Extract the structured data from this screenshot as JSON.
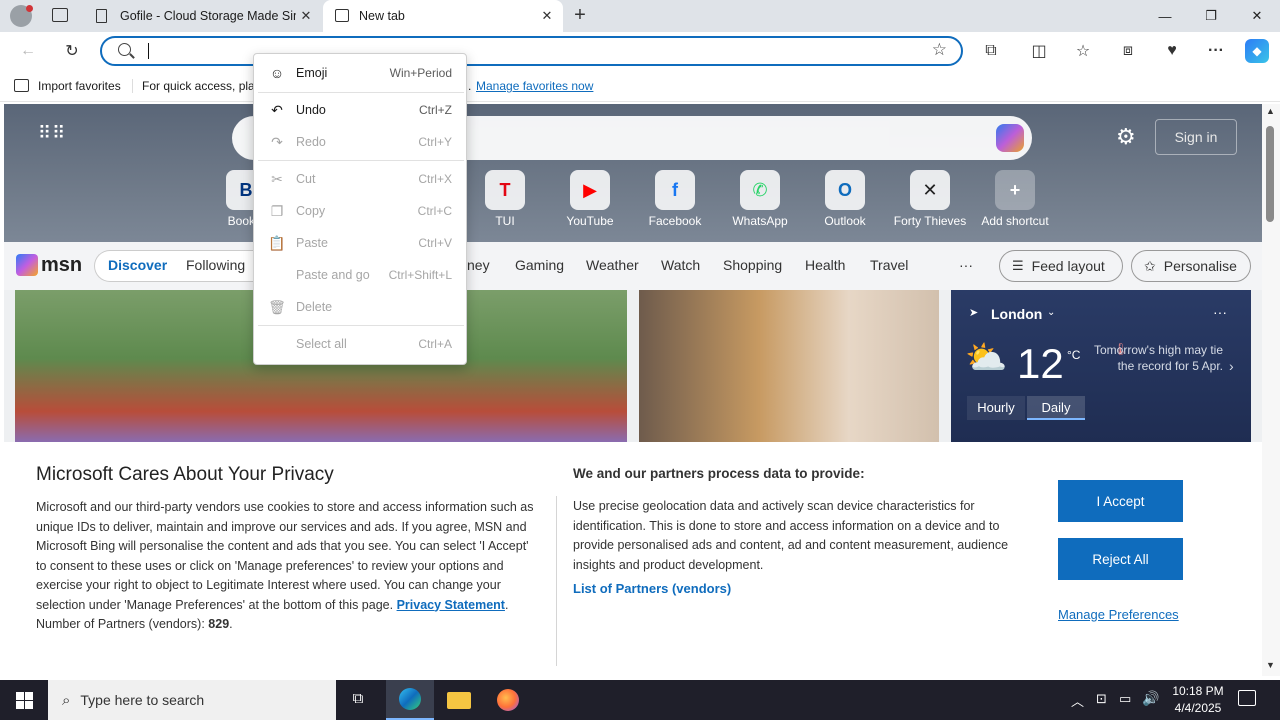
{
  "tabs": [
    {
      "title": "Gofile - Cloud Storage Made Simple"
    },
    {
      "title": "New tab"
    }
  ],
  "address": {
    "value": ""
  },
  "favorites": {
    "import_label": "Import favorites",
    "hint_prefix": "For quick access, plac",
    "hint_suffix": ".",
    "manage_link": "Manage favorites now"
  },
  "context_menu": {
    "items": [
      {
        "label": "Emoji",
        "shortcut": "Win+Period",
        "icon": "emoji-icon",
        "enabled": true
      },
      {
        "label": "Undo",
        "shortcut": "Ctrl+Z",
        "icon": "undo-icon",
        "enabled": true
      },
      {
        "label": "Redo",
        "shortcut": "Ctrl+Y",
        "icon": "redo-icon",
        "enabled": false
      },
      {
        "label": "Cut",
        "shortcut": "Ctrl+X",
        "icon": "cut-icon",
        "enabled": false
      },
      {
        "label": "Copy",
        "shortcut": "Ctrl+C",
        "icon": "copy-icon",
        "enabled": false
      },
      {
        "label": "Paste",
        "shortcut": "Ctrl+V",
        "icon": "paste-icon",
        "enabled": false
      },
      {
        "label": "Paste and go",
        "shortcut": "Ctrl+Shift+L",
        "icon": "paste-go-icon",
        "enabled": false
      },
      {
        "label": "Delete",
        "shortcut": "",
        "icon": "delete-icon",
        "enabled": false
      },
      {
        "label": "Select all",
        "shortcut": "Ctrl+A",
        "icon": "",
        "enabled": false
      }
    ]
  },
  "newtab": {
    "sign_in": "Sign in",
    "shortcuts": [
      {
        "label": "Bookin",
        "glyph": "B"
      },
      {
        "label": "TUI",
        "glyph": "T"
      },
      {
        "label": "YouTube",
        "glyph": "▶"
      },
      {
        "label": "Facebook",
        "glyph": "f"
      },
      {
        "label": "WhatsApp",
        "glyph": "✆"
      },
      {
        "label": "Outlook",
        "glyph": "O"
      },
      {
        "label": "Forty Thieves",
        "glyph": "✕"
      },
      {
        "label": "Add shortcut",
        "glyph": "+"
      }
    ],
    "msn_logo": "msn",
    "nav": [
      "Discover",
      "Following",
      "ney",
      "Gaming",
      "Weather",
      "Watch",
      "Shopping",
      "Health",
      "Travel"
    ],
    "more": "···",
    "feed_layout": "Feed layout",
    "personalise": "Personalise",
    "weather": {
      "city": "London",
      "temp": "12",
      "unit": "°C",
      "note": "Tomorrow's high may tie the record for 5 Apr.",
      "tab_hourly": "Hourly",
      "tab_daily": "Daily"
    }
  },
  "privacy": {
    "title": "Microsoft Cares About Your Privacy",
    "body": "Microsoft and our third-party vendors use cookies to store and access information such as unique IDs to deliver, maintain and improve our services and ads. If you agree, MSN and Microsoft Bing will personalise the content and ads that you see. You can select 'I Accept' to consent to these uses or click on 'Manage preferences' to review your options and exercise your right to object to Legitimate Interest where used.  You can change your selection under 'Manage Preferences' at the bottom of this page.",
    "privacy_link": "Privacy Statement",
    "partners_label": "Number of Partners (vendors):",
    "partners_count": "829",
    "partners_suffix": ".",
    "right_title": "We and our partners process data to provide:",
    "right_body": "Use precise geolocation data and actively scan device characteristics for identification. This is done to store and access information on a device and to provide personalised ads and content, ad and content measurement, audience insights and product development.",
    "vendors_link": "List of Partners (vendors)",
    "accept": "I Accept",
    "reject": "Reject All",
    "manage": "Manage Preferences"
  },
  "taskbar": {
    "search_placeholder": "Type here to search",
    "time": "10:18 PM",
    "date": "4/4/2025"
  },
  "colors": {
    "accent": "#0f6cbd",
    "taskbar": "#1f1f2a",
    "tabbar": "#dfe3e8"
  }
}
